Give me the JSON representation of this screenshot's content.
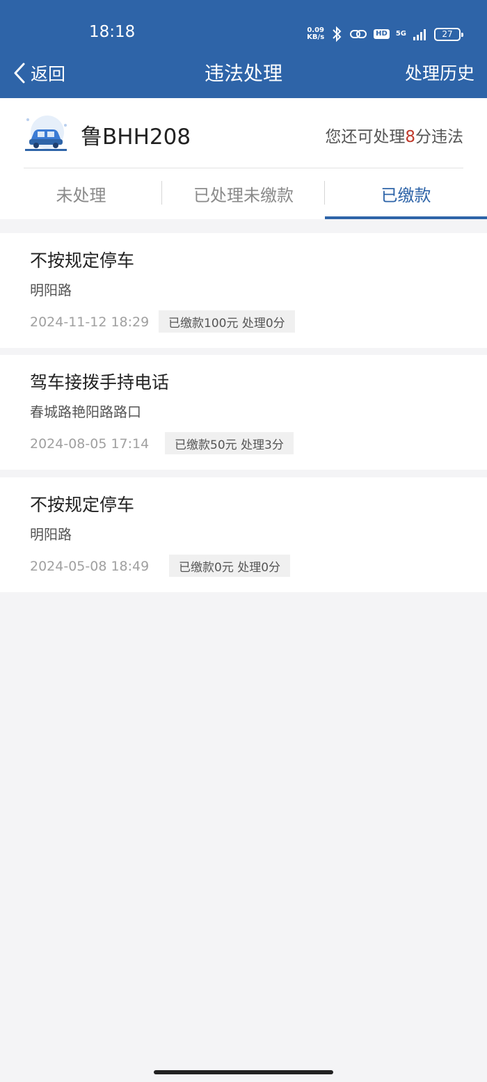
{
  "status_bar": {
    "time": "18:18",
    "net_speed_value": "0.09",
    "net_speed_unit": "KB/s",
    "hd": "HD",
    "network": "5G",
    "battery": "27"
  },
  "nav": {
    "back_label": "返回",
    "title": "违法处理",
    "history_label": "处理历史"
  },
  "vehicle": {
    "plate": "鲁BHH208",
    "points_prefix": "您还可处理",
    "points_value": "8",
    "points_suffix": "分违法"
  },
  "tabs": [
    {
      "label": "未处理",
      "active": false
    },
    {
      "label": "已处理未缴款",
      "active": false
    },
    {
      "label": "已缴款",
      "active": true
    }
  ],
  "records": [
    {
      "title": "不按规定停车",
      "location": "明阳路",
      "datetime": "2024-11-12 18:29",
      "badge": "已缴款100元 处理0分"
    },
    {
      "title": "驾车接拨手持电话",
      "location": "春城路艳阳路路口",
      "datetime": "2024-08-05 17:14",
      "badge": "已缴款50元 处理3分"
    },
    {
      "title": "不按规定停车",
      "location": "明阳路",
      "datetime": "2024-05-08 18:49",
      "badge": "已缴款0元 处理0分"
    }
  ],
  "colors": {
    "primary": "#2e64a8",
    "highlight": "#c0392b",
    "background": "#f4f4f6"
  }
}
